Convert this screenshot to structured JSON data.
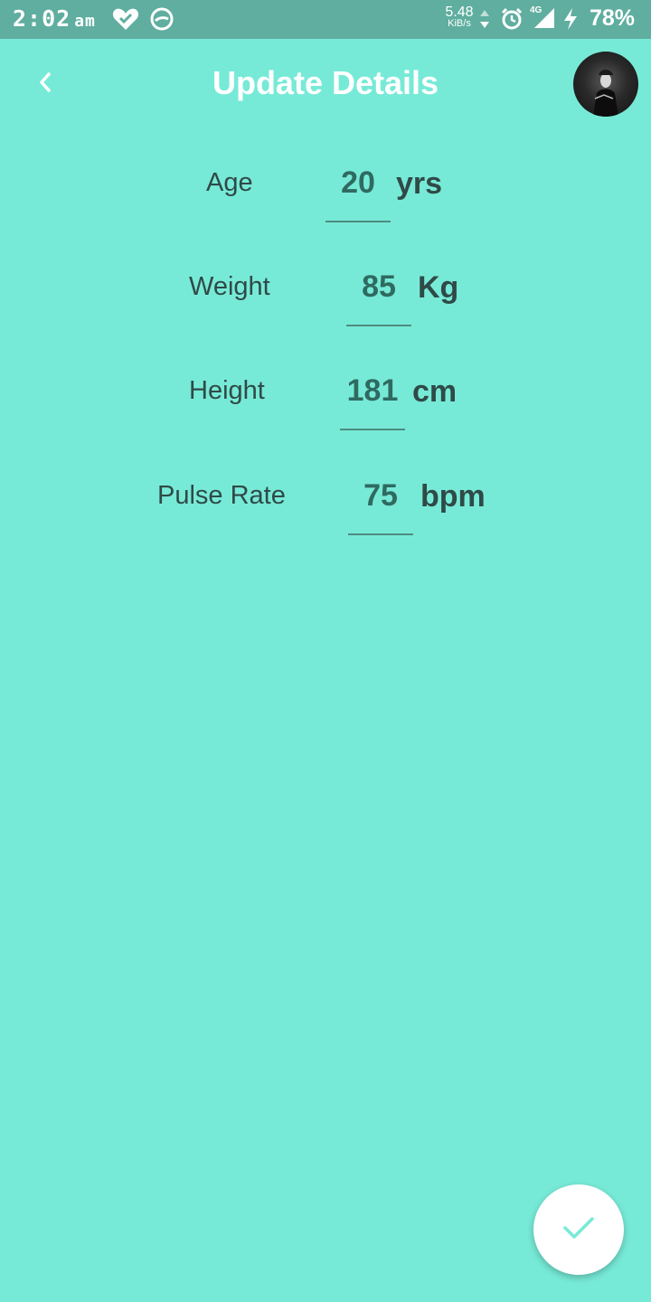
{
  "status_bar": {
    "time": "2:02",
    "ampm": "am",
    "net_speed": "5.48",
    "net_speed_unit": "KiB/s",
    "network_type": "4G",
    "battery": "78%",
    "icons": [
      "heart-check-icon",
      "chat-bubble-icon",
      "data-arrows-icon",
      "alarm-icon",
      "signal-icon",
      "charging-bolt-icon"
    ]
  },
  "header": {
    "title": "Update Details",
    "back_icon": "chevron-left-icon",
    "avatar": "profile-photo"
  },
  "fields": [
    {
      "label": "Age",
      "value": "20",
      "unit": "yrs"
    },
    {
      "label": "Weight",
      "value": "85",
      "unit": "Kg"
    },
    {
      "label": "Height",
      "value": "181",
      "unit": "cm"
    },
    {
      "label": "Pulse Rate",
      "value": "75",
      "unit": "bpm"
    }
  ],
  "fab": {
    "icon": "check-icon"
  },
  "colors": {
    "background": "#77EAD7",
    "status_bar": "#5FAE9F",
    "title": "#FFFFFF",
    "value_text": "#2F6A60",
    "label_text": "#2F4A47",
    "fab_check": "#77EAD7"
  }
}
